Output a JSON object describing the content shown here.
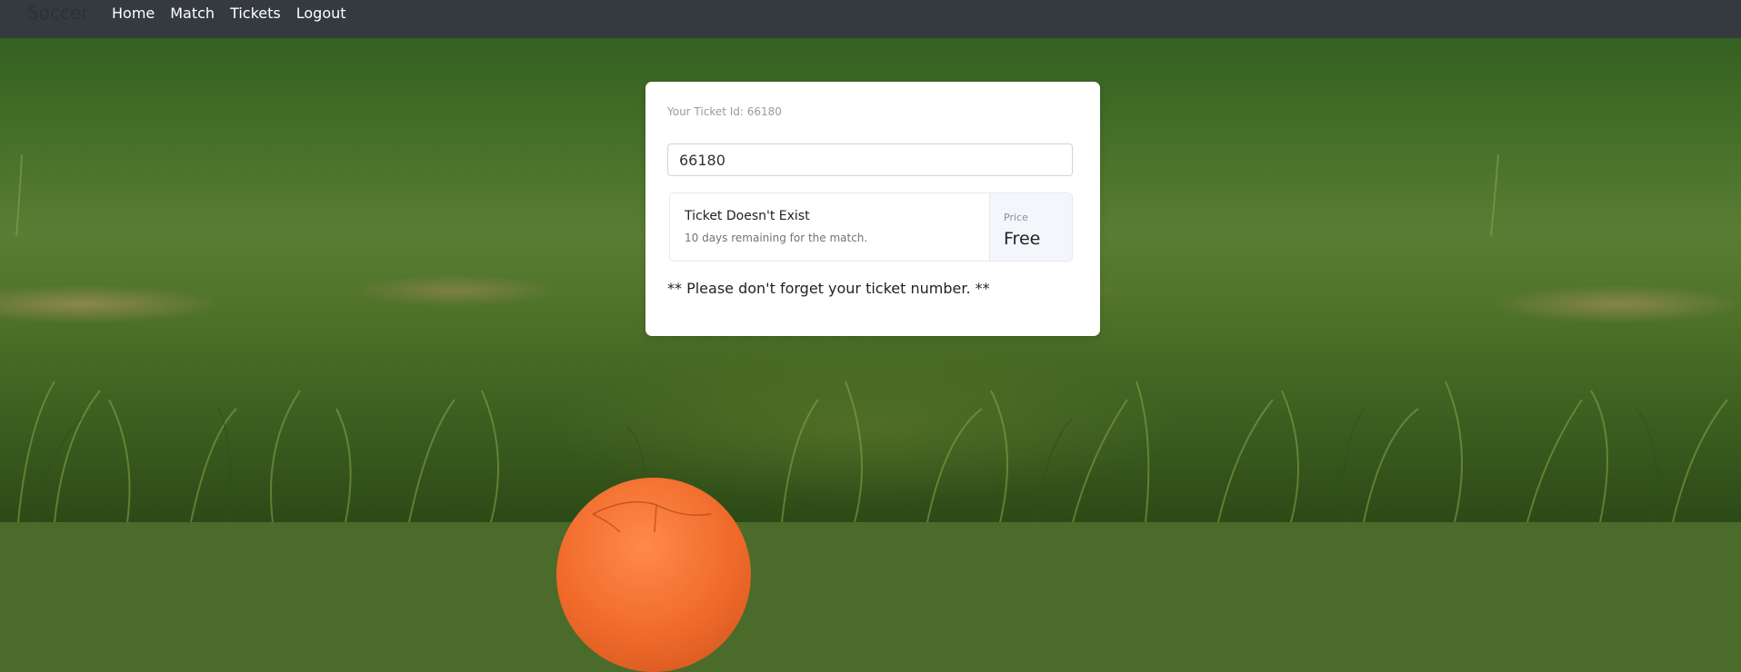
{
  "navbar": {
    "brand": "Soccer",
    "links": [
      "Home",
      "Match",
      "Tickets",
      "Logout"
    ]
  },
  "ticket": {
    "id_label": "Your Ticket Id: 66180",
    "input_value": "66180",
    "status": "Ticket Doesn't Exist",
    "remaining": "10 days remaining for the match.",
    "price_label": "Price",
    "price_value": "Free",
    "reminder": "** Please don't forget your ticket number. **"
  },
  "colors": {
    "navbar_bg": "#343a40",
    "card_bg": "#ffffff",
    "ball": "#f06a2a",
    "grass": "#4a6b2a"
  }
}
